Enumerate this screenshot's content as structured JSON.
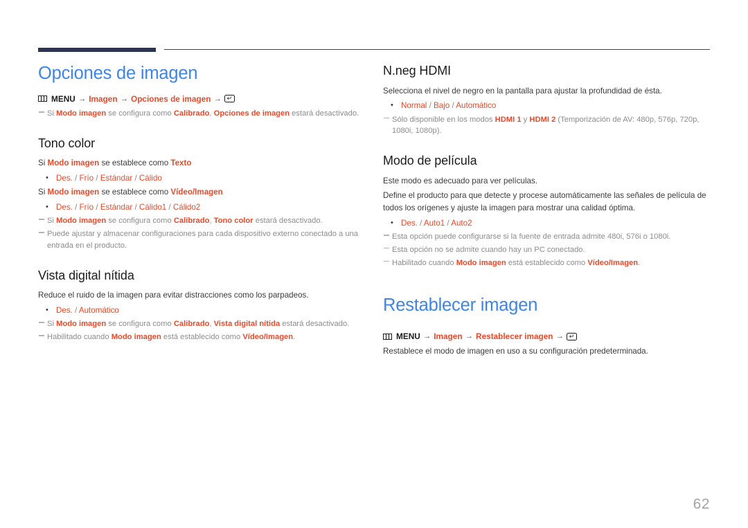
{
  "page": {
    "number": "62",
    "accent_blue": "#3d85e8",
    "accent_orange": "#e8492a",
    "rule_navy": "#2d3355"
  },
  "icons": {
    "menu": "menu-grid-icon",
    "enter": "enter-key-icon",
    "arrow": "→",
    "enter_glyph": "↵",
    "bullet": "•"
  },
  "left_column": {
    "title": "Opciones de imagen",
    "menu_path": {
      "menu_label": "MENU",
      "step1": "Imagen",
      "step2": "Opciones de imagen"
    },
    "intro_note": {
      "p1": "Si ",
      "b1": "Modo imagen",
      "p2": " se configura como ",
      "b2": "Calibrado",
      "p3": ", ",
      "b3": "Opciones de imagen",
      "p4": " estará desactivado."
    },
    "sections": [
      {
        "title": "Tono color",
        "cond1": {
          "pre": "Si ",
          "a": "Modo imagen",
          "mid": " se establece como ",
          "b": "Texto"
        },
        "options1": "Des. / Frío / Estándar / Cálido",
        "cond2": {
          "pre": "Si ",
          "a": "Modo imagen",
          "mid": " se establece como ",
          "b": "Vídeo/Imagen"
        },
        "options2": "Des. / Frío / Estándar / Cálido1 / Cálido2",
        "note1": {
          "p1": "Si ",
          "b1": "Modo imagen",
          "p2": " se configura como ",
          "b2": "Calibrado",
          "p3": ", ",
          "b3": "Tono color",
          "p4": " estará desactivado."
        },
        "note2": "Puede ajustar y almacenar configuraciones para cada dispositivo externo conectado a una entrada en el producto."
      },
      {
        "title": "Vista digital nítida",
        "desc": "Reduce el ruido de la imagen para evitar distracciones como los parpadeos.",
        "options": "Des. / Automático",
        "note1": {
          "p1": "Si ",
          "b1": "Modo imagen",
          "p2": " se configura como ",
          "b2": "Calibrado",
          "p3": ", ",
          "b3": "Vista digital nítida",
          "p4": " estará desactivado."
        },
        "note2": {
          "p1": "Habilitado cuando ",
          "b1": "Modo imagen",
          "p2": " está establecido como ",
          "b2": "Vídeo/Imagen",
          "p3": "."
        }
      }
    ]
  },
  "right_column": {
    "sections": [
      {
        "title": "N.neg HDMI",
        "desc": "Selecciona el nivel de negro en la pantalla para ajustar la profundidad de ésta.",
        "options": "Normal / Bajo / Automático",
        "note": {
          "p1": "Sólo disponible en los modos ",
          "b1": "HDMI 1",
          "p2": " y ",
          "b2": "HDMI 2",
          "p3": " (Temporización de AV: 480p, 576p, 720p, 1080i, 1080p)."
        }
      },
      {
        "title": "Modo de película",
        "desc1": "Este modo es adecuado para ver películas.",
        "desc2": "Define el producto para que detecte y procese automáticamente las señales de película de todos los orígenes y ajuste la imagen para mostrar una calidad óptima.",
        "options": "Des. / Auto1 / Auto2",
        "note1": "Esta opción puede configurarse si la fuente de entrada admite 480i, 576i o 1080i.",
        "note2": "Esta opción no se admite cuando hay un PC conectado.",
        "note3": {
          "p1": "Habilitado cuando ",
          "b1": "Modo imagen",
          "p2": " está establecido como ",
          "b2": "Vídeo/Imagen",
          "p3": "."
        }
      }
    ],
    "reset_title": "Restablecer imagen",
    "reset_menu_path": {
      "menu_label": "MENU",
      "step1": "Imagen",
      "step2": "Restablecer imagen"
    },
    "reset_desc": "Restablece el modo de imagen en uso a su configuración predeterminada."
  }
}
